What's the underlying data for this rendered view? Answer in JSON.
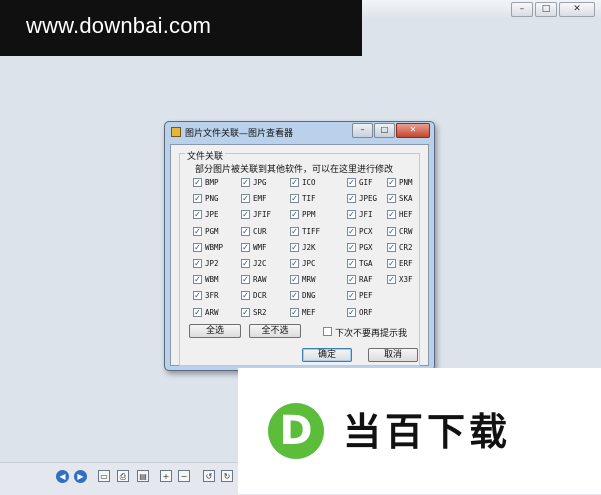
{
  "outer": {
    "buttons": [
      "–",
      "□",
      "✕"
    ]
  },
  "watermark": "www.downbai.com",
  "dialog": {
    "title": "图片文件关联—图片查看器",
    "title_buttons": [
      "–",
      "□",
      "✕"
    ],
    "group_label": "文件关联",
    "group_hint": "部分图片被关联到其他软件，可以在这里进行修改",
    "formats": [
      [
        "BMP",
        "JPG",
        "ICO",
        "GIF",
        "PNM"
      ],
      [
        "PNG",
        "EMF",
        "TIF",
        "JPEG",
        "SKA"
      ],
      [
        "JPE",
        "JFIF",
        "PPM",
        "JFI",
        "HEF"
      ],
      [
        "PGM",
        "CUR",
        "TIFF",
        "PCX",
        "CRW"
      ],
      [
        "WBMP",
        "WMF",
        "J2K",
        "PGX",
        "CR2"
      ],
      [
        "JP2",
        "J2C",
        "JPC",
        "TGA",
        "ERF"
      ],
      [
        "WBM",
        "RAW",
        "MRW",
        "RAF",
        "X3F"
      ],
      [
        "3FR",
        "DCR",
        "DNG",
        "PEF",
        ""
      ],
      [
        "ARW",
        "SR2",
        "MEF",
        "ORF",
        ""
      ]
    ],
    "select_all": "全选",
    "select_none": "全不选",
    "dont_prompt": "下次不要再提示我",
    "ok": "确定",
    "cancel": "取消",
    "check_mark": "✓"
  },
  "toolbar_icons": [
    "prev-icon",
    "next-icon",
    "fit-icon",
    "print-icon",
    "slideshow-icon",
    "zoom-in-icon",
    "zoom-out-icon",
    "rotate-left-icon",
    "rotate-right-icon"
  ],
  "logo": {
    "letter": "D",
    "text": "当百下载"
  }
}
